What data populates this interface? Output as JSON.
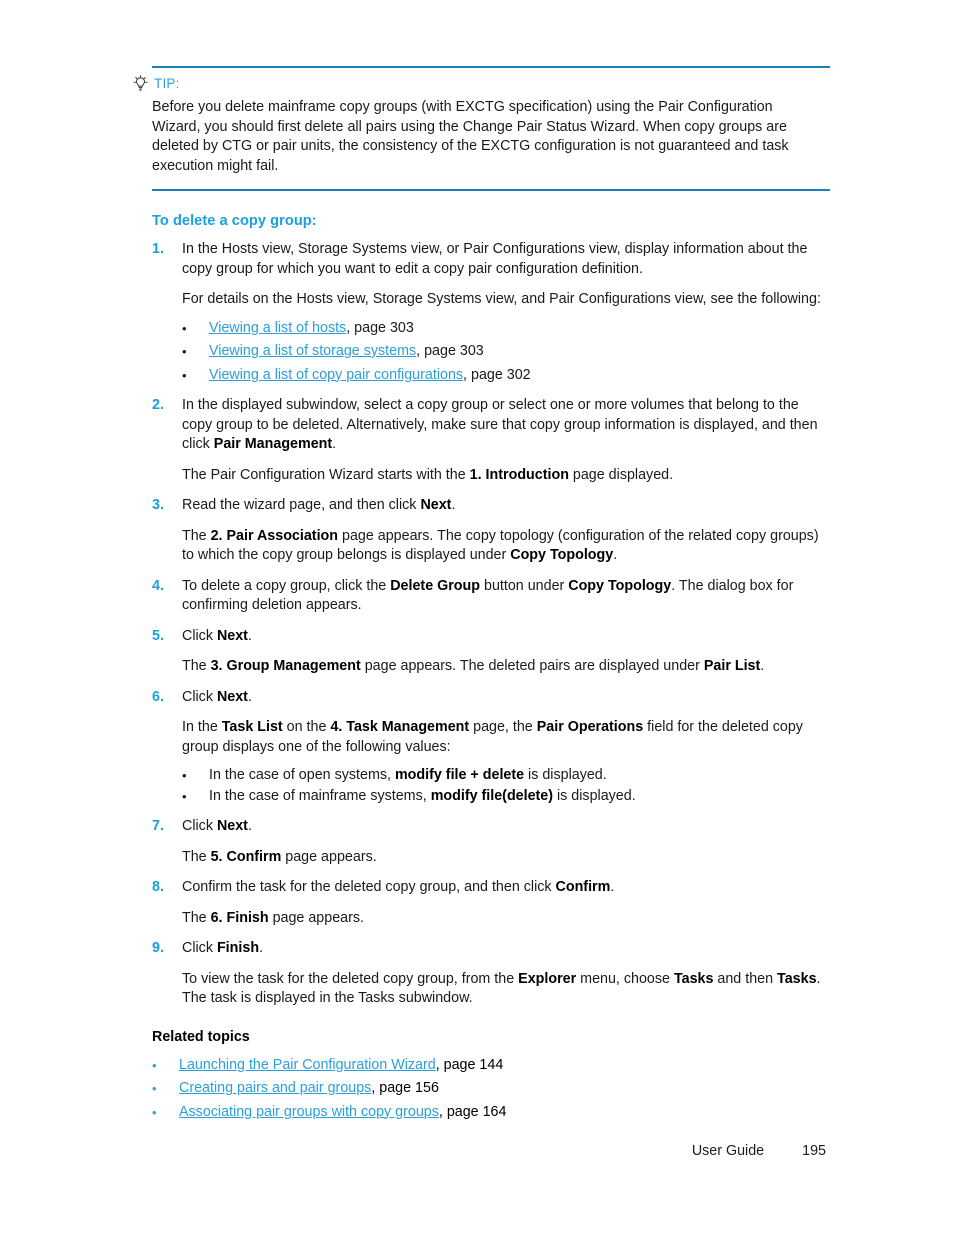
{
  "document": {
    "note": {
      "icon": "lightbulb-tip-icon",
      "label": "TIP:",
      "body": "Before you delete mainframe copy groups (with EXCTG specification) using the Pair Configuration Wizard, you should first delete all pairs using the Change Pair Status Wizard. When copy groups are deleted by CTG or pair units, the consistency of the EXCTG configuration is not guaranteed and task execution might fail."
    },
    "section_heading": "To delete a copy group:",
    "steps": [
      {
        "num": "1.",
        "paragraphs": [
          "In the Hosts view, Storage Systems view, or Pair Configurations view, display information about the copy group for which you want to edit a copy pair configuration definition.",
          "For details on the Hosts view, Storage Systems view, and Pair Configurations view, see the following:"
        ],
        "bullets": [
          {
            "bullet": "•",
            "link": "Viewing a list of hosts",
            "tail": ", page 303"
          },
          {
            "bullet": "•",
            "link": "Viewing a list of storage systems",
            "tail": ", page 303"
          },
          {
            "bullet": "•",
            "link": "Viewing a list of copy pair configurations",
            "tail": ", page 302"
          }
        ]
      },
      {
        "num": "2.",
        "para1_a": "In the displayed subwindow, select a copy group or select one or more volumes that belong to the copy group to be deleted. Alternatively, make sure that copy group information is displayed, and then click ",
        "para1_b": "Pair Management",
        "para1_c": ".",
        "para2_a": "The Pair Configuration Wizard starts with the ",
        "para2_b": "1. Introduction",
        "para2_c": " page displayed."
      },
      {
        "num": "3.",
        "para1_a": "Read the wizard page, and then click ",
        "para1_b": "Next",
        "para1_c": ".",
        "para2_a": "The ",
        "para2_b": "2. Pair Association",
        "para2_c": " page appears. The copy topology (configuration of the related copy groups) to which the copy group belongs is displayed under ",
        "para2_d": "Copy Topology",
        "para2_e": "."
      },
      {
        "num": "4.",
        "para1_a": "To delete a copy group, click the ",
        "para1_b": "Delete Group",
        "para1_c": " button under ",
        "para1_d": "Copy Topology",
        "para1_e": ". The dialog box for confirming deletion appears."
      },
      {
        "num": "5.",
        "para1_a": "Click ",
        "para1_b": "Next",
        "para1_c": ".",
        "para2_a": "The ",
        "para2_b": "3. Group Management",
        "para2_c": " page appears. The deleted pairs are displayed under ",
        "para2_d": "Pair List",
        "para2_e": "."
      },
      {
        "num": "6.",
        "para1_a": "Click ",
        "para1_b": "Next",
        "para1_c": ".",
        "para2_a": "In the ",
        "para2_b": "Task List",
        "para2_c": "  on the ",
        "para2_d": "4. Task Management",
        "para2_e": " page, the ",
        "para2_f": "Pair Operations",
        "para2_g": " field for the deleted copy group displays one of the following values:",
        "bullets": [
          {
            "bullet": "•",
            "pre": "In the case of open systems, ",
            "bold": "modify file + delete",
            "post": " is displayed."
          },
          {
            "bullet": "•",
            "pre": "In the case of mainframe systems, ",
            "bold": "modify file(delete)",
            "post": " is displayed."
          }
        ]
      },
      {
        "num": "7.",
        "para1_a": "Click ",
        "para1_b": "Next",
        "para1_c": ".",
        "para2_a": "The ",
        "para2_b": "5. Confirm",
        "para2_c": " page appears."
      },
      {
        "num": "8.",
        "para1_a": "Confirm the task for the deleted copy group, and then click ",
        "para1_b": "Confirm",
        "para1_c": ".",
        "para2_a": "The ",
        "para2_b": "6. Finish",
        "para2_c": " page appears."
      },
      {
        "num": "9.",
        "para1_a": "Click ",
        "para1_b": "Finish",
        "para1_c": ".",
        "para2_a": "To view the task for the deleted copy group, from the ",
        "para2_b": "Explorer",
        "para2_c": " menu, choose ",
        "para2_d": "Tasks",
        "para2_e": " and then ",
        "para2_f": "Tasks",
        "para2_g": ". The task is displayed in the Tasks subwindow."
      }
    ],
    "related": {
      "heading": "Related topics",
      "items": [
        {
          "bullet": "•",
          "link": "Launching the Pair Configuration Wizard",
          "tail": ", page 144"
        },
        {
          "bullet": "•",
          "link": "Creating pairs and pair groups",
          "tail": ", page 156"
        },
        {
          "bullet": "•",
          "link": "Associating pair groups with copy groups",
          "tail": ", page 164"
        }
      ]
    },
    "footer": {
      "label": "User Guide",
      "page_number": "195"
    },
    "colors": {
      "accent_blue": "#1aa0dd",
      "link_blue": "#2b9fd9",
      "rule_blue": "#1b7fb8",
      "text_black": "#1a1a1a"
    }
  }
}
